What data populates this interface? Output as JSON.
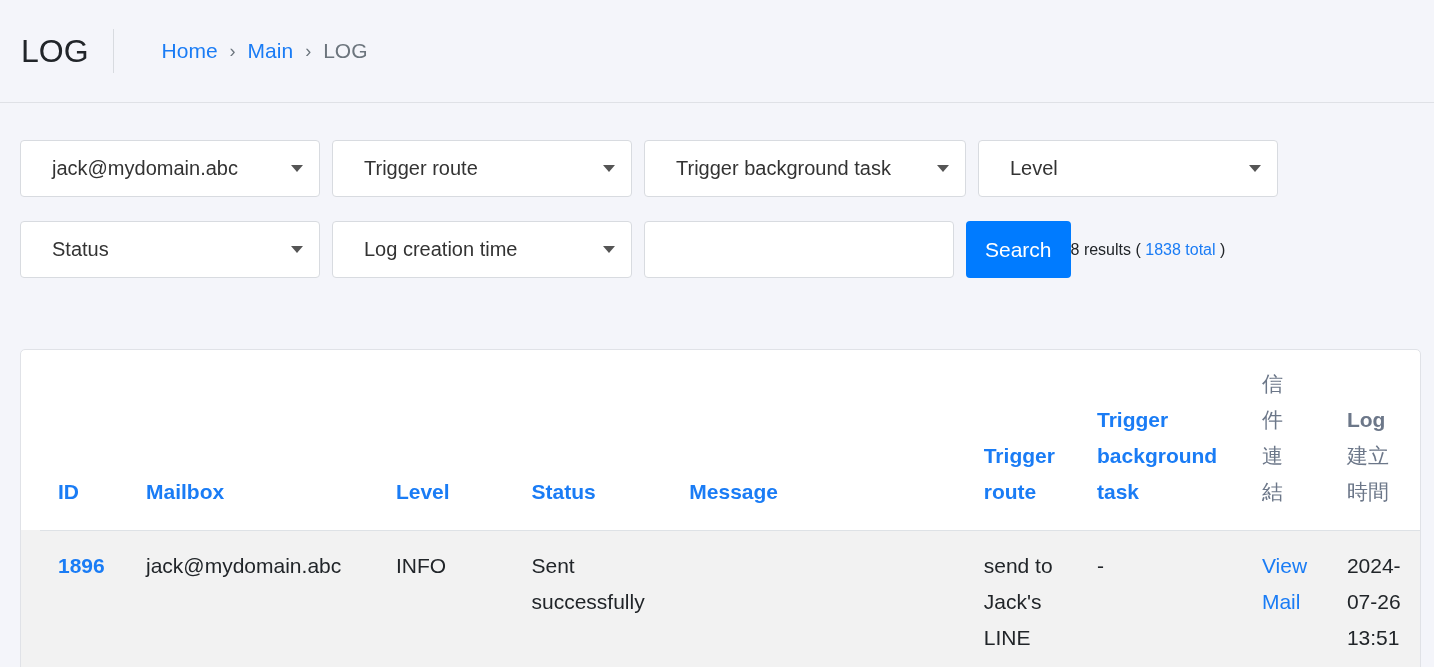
{
  "header": {
    "title": "LOG",
    "breadcrumb": [
      {
        "label": "Home",
        "link": true
      },
      {
        "label": "Main",
        "link": true
      },
      {
        "label": "LOG",
        "link": false
      }
    ],
    "separator": "›"
  },
  "filters": [
    {
      "kind": "select",
      "label": "jack@mydomain.abc"
    },
    {
      "kind": "select",
      "label": "Trigger route"
    },
    {
      "kind": "select",
      "label": "Trigger background task"
    },
    {
      "kind": "select",
      "label": "Level"
    },
    {
      "kind": "break"
    },
    {
      "kind": "select",
      "label": "Status"
    },
    {
      "kind": "select",
      "label": "Log creation time"
    },
    {
      "kind": "input"
    },
    {
      "kind": "button",
      "label": "Search"
    },
    {
      "kind": "results",
      "count": "8 results (",
      "total": "1838 total",
      "close": ")"
    }
  ],
  "table": {
    "columns": [
      {
        "label": "ID",
        "sortable": true
      },
      {
        "label": "Mailbox",
        "sortable": true
      },
      {
        "label": "Level",
        "sortable": true
      },
      {
        "label": "Status",
        "sortable": true
      },
      {
        "label": "Message",
        "sortable": true
      },
      {
        "label": "Trigger route",
        "sortable": true
      },
      {
        "label": "Trigger background task",
        "sortable": true
      },
      {
        "label": "信件連結",
        "sortable": false,
        "vertical": true
      },
      {
        "label": "**Log** 建立時間",
        "sortable": false
      }
    ],
    "rows": [
      {
        "id": "1896",
        "mailbox": "jack@mydomain.abc",
        "level": "INFO",
        "status": "Sent successfully",
        "trigger_route": "send to Jack's LINE",
        "trigger_background_task": "-",
        "mail_link": "View Mail",
        "created": "2024-07-26 13:51"
      }
    ]
  }
}
